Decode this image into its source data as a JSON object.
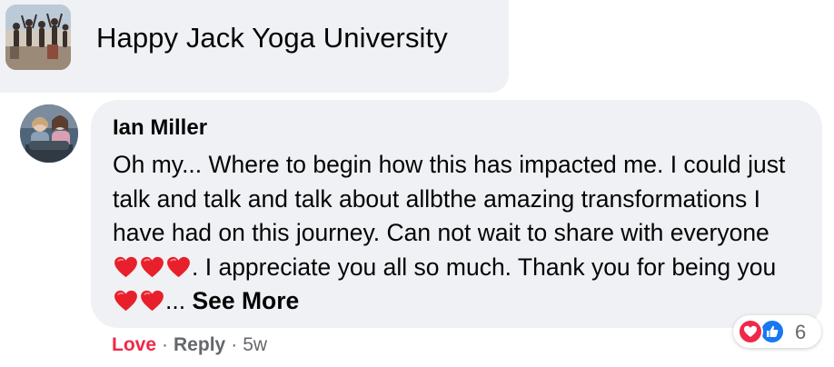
{
  "group": {
    "name": "Happy Jack Yoga University"
  },
  "comment": {
    "author": "Ian Miller",
    "text_part1": "Oh my... Where to begin how this has impacted me. I could just talk and talk and talk about allbthe amazing transformations I have had on this journey. Can not wait to share with everyone ",
    "text_part2": ". I appreciate you all so much. Thank you for being you",
    "text_part3": "... ",
    "see_more": "See More",
    "emoji": "red-heart-icon"
  },
  "reactions": {
    "count": "6",
    "types": [
      "love",
      "like"
    ]
  },
  "actions": {
    "love_label": "Love",
    "separator": "·",
    "reply_label": "Reply",
    "time": "5w"
  },
  "colors": {
    "bubble": "#eff1f4",
    "love": "#f02849",
    "like": "#1877f2",
    "meta": "#65676b"
  }
}
